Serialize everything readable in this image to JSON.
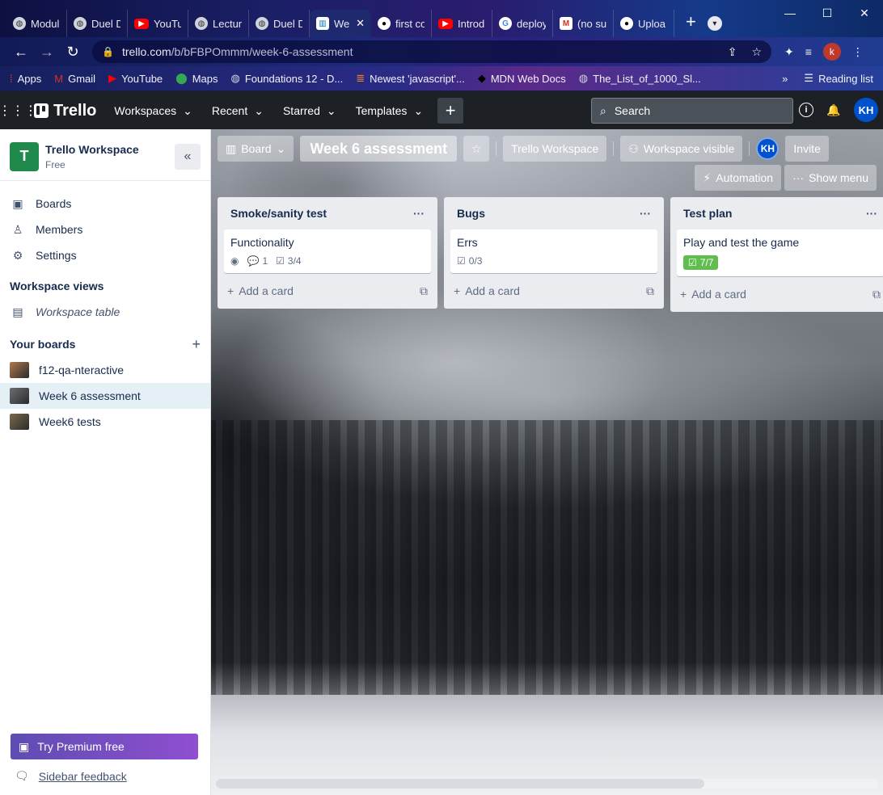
{
  "browser": {
    "tabs": [
      {
        "label": "Modul",
        "icon": "globe-icon",
        "active": false
      },
      {
        "label": "Duel D",
        "icon": "globe-icon",
        "active": false
      },
      {
        "label": "YouTu",
        "icon": "youtube-icon",
        "active": false
      },
      {
        "label": "Lectur",
        "icon": "globe-icon",
        "active": false
      },
      {
        "label": "Duel D",
        "icon": "globe-icon",
        "active": false
      },
      {
        "label": "We",
        "icon": "trello-icon",
        "active": true
      },
      {
        "label": "first co",
        "icon": "github-icon",
        "active": false
      },
      {
        "label": "Introdu",
        "icon": "youtube-icon",
        "active": false
      },
      {
        "label": "deploy",
        "icon": "google-icon",
        "active": false
      },
      {
        "label": "(no sub",
        "icon": "gmail-icon",
        "active": false
      },
      {
        "label": "Uploa",
        "icon": "github-icon",
        "active": false
      }
    ],
    "url_host": "trello.com",
    "url_path": "/b/bFBPOmmm/week-6-assessment",
    "profile_initial": "k",
    "bookmarks": [
      {
        "label": "Apps",
        "icon": "apps-grid-icon",
        "color": "#ea4335"
      },
      {
        "label": "Gmail",
        "icon": "gmail-icon",
        "color": "#d93025"
      },
      {
        "label": "YouTube",
        "icon": "youtube-icon",
        "color": "#ff0000"
      },
      {
        "label": "Maps",
        "icon": "maps-pin-icon",
        "color": "#34a853"
      },
      {
        "label": "Foundations 12 - D...",
        "icon": "globe-icon",
        "color": "#cfd3dc"
      },
      {
        "label": "Newest 'javascript'...",
        "icon": "stackoverflow-icon",
        "color": "#f48024"
      },
      {
        "label": "MDN Web Docs",
        "icon": "mdn-icon",
        "color": "#000000"
      },
      {
        "label": "The_List_of_1000_Sl...",
        "icon": "globe-icon",
        "color": "#cfd3dc"
      }
    ],
    "reading_list": "Reading list"
  },
  "trello_header": {
    "logo": "Trello",
    "nav": [
      "Workspaces",
      "Recent",
      "Starred",
      "Templates"
    ],
    "search_placeholder": "Search",
    "user_initials": "KH"
  },
  "sidebar": {
    "workspace_initial": "T",
    "workspace_name": "Trello Workspace",
    "workspace_plan": "Free",
    "items": [
      {
        "label": "Boards",
        "icon": "board-icon"
      },
      {
        "label": "Members",
        "icon": "person-icon"
      },
      {
        "label": "Settings",
        "icon": "gear-icon"
      }
    ],
    "views_heading": "Workspace views",
    "views": [
      {
        "label": "Workspace table",
        "icon": "table-icon"
      }
    ],
    "boards_heading": "Your boards",
    "boards": [
      {
        "label": "f12-qa-nteractive",
        "selected": false,
        "color": "#b07a4e"
      },
      {
        "label": "Week 6 assessment",
        "selected": true,
        "color": "#6b6f75"
      },
      {
        "label": "Week6 tests",
        "selected": false,
        "color": "#7a6a4e"
      }
    ],
    "premium": "Try Premium free",
    "feedback": "Sidebar feedback"
  },
  "board": {
    "view_label": "Board",
    "title": "Week 6 assessment",
    "workspace": "Trello Workspace",
    "visibility": "Workspace visible",
    "member_initials": "KH",
    "invite": "Invite",
    "automation": "Automation",
    "show_menu": "Show menu",
    "add_card": "Add a card",
    "lists": [
      {
        "title": "Smoke/sanity test",
        "cards": [
          {
            "title": "Functionality",
            "watch": true,
            "comments": "1",
            "checklist": "3/4",
            "complete": false
          }
        ]
      },
      {
        "title": "Bugs",
        "cards": [
          {
            "title": "Errs",
            "watch": false,
            "comments": "",
            "checklist": "0/3",
            "complete": false
          }
        ]
      },
      {
        "title": "Test plan",
        "cards": [
          {
            "title": "Play and test the game",
            "watch": false,
            "comments": "",
            "checklist": "7/7",
            "complete": true
          }
        ]
      }
    ]
  }
}
